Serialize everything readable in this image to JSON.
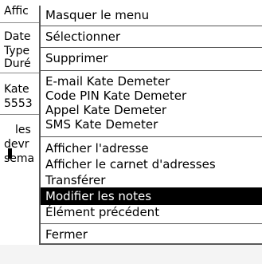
{
  "background": {
    "lines": [
      "Affic",
      "Date",
      "Type",
      "Duré",
      "Kate",
      "5553",
      "les",
      "devr",
      "sema"
    ]
  },
  "menu": {
    "items": [
      "Masquer le menu",
      "Sélectionner",
      "Supprimer",
      "E-mail Kate Demeter",
      "Code PIN Kate Demeter",
      "Appel Kate Demeter",
      "SMS Kate Demeter",
      "Afficher l'adresse",
      "Afficher le carnet d'adresses",
      "Transférer",
      "Modifier les notes",
      "Élément précédent",
      "Fermer"
    ],
    "selected_index": 10
  },
  "colors": {
    "selected_bg": "#000000",
    "selected_text": "#ffffff"
  }
}
